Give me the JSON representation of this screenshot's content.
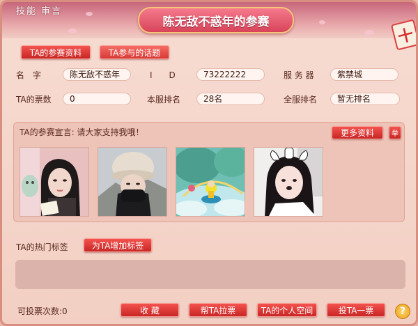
{
  "header": {
    "title": "陈无敌不惑年的参赛",
    "top_left_text": "技能 审言",
    "close_glyph": "十"
  },
  "tabs": [
    {
      "label": "TA的参赛资料",
      "active": true
    },
    {
      "label": "TA参与的话题",
      "active": false
    }
  ],
  "info": {
    "name_label": "名　字",
    "name_value": "陈无敌不惑年",
    "id_label": "I　　D",
    "id_value": "73222222",
    "server_label": "服 务 器",
    "server_value": "紫禁城",
    "votes_label": "TA的票数",
    "votes_value": "0",
    "server_rank_label": "本服排名",
    "server_rank_value": "28名",
    "all_rank_label": "全服排名",
    "all_rank_value": "暂无排名"
  },
  "declaration": {
    "text": "TA的参赛宣言: 请大家支持我哦！",
    "more_button": "更多资料",
    "report_button": "举"
  },
  "photos": [
    {
      "name": "photo-girl-book"
    },
    {
      "name": "photo-girl-hat"
    },
    {
      "name": "photo-game-character"
    },
    {
      "name": "photo-girl-dog-filter"
    }
  ],
  "tags": {
    "label": "TA的热门标签",
    "add_button": "为TA增加标签"
  },
  "footer": {
    "remaining_votes": "可投票次数:0",
    "favorite_button": "收 藏",
    "help_vote_button": "帮TA拉票",
    "space_button": "TA的个人空间",
    "vote_button": "投TA一票",
    "help_glyph": "?"
  },
  "colors": {
    "accent_red": "#d8302c",
    "panel": "#efc4b8",
    "background": "#f5d6cb"
  }
}
